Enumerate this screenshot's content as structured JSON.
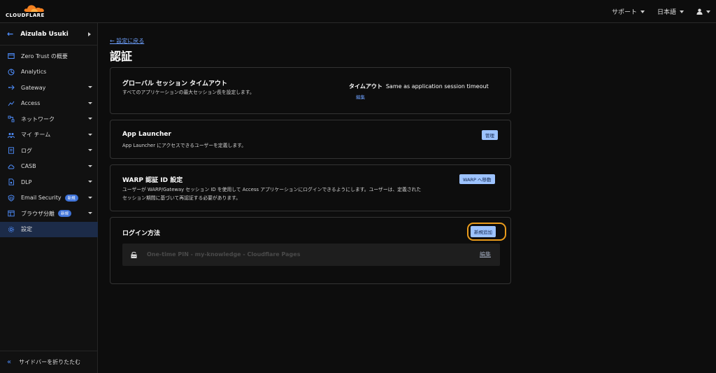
{
  "topbar": {
    "logo_text": "CLOUDFLARE",
    "support_label": "サポート",
    "language_label": "日本語"
  },
  "sidebar": {
    "account_name": "Aizulab Usuki",
    "items": [
      {
        "label": "Zero Trust の概要",
        "icon": "overview-icon",
        "has_dropdown": false
      },
      {
        "label": "Analytics",
        "icon": "analytics-icon",
        "has_dropdown": false
      },
      {
        "label": "Gateway",
        "icon": "gateway-icon",
        "has_dropdown": true
      },
      {
        "label": "Access",
        "icon": "access-icon",
        "has_dropdown": true
      },
      {
        "label": "ネットワーク",
        "icon": "network-icon",
        "has_dropdown": true
      },
      {
        "label": "マイ チーム",
        "icon": "team-icon",
        "has_dropdown": true
      },
      {
        "label": "ログ",
        "icon": "logs-icon",
        "has_dropdown": true
      },
      {
        "label": "CASB",
        "icon": "casb-icon",
        "has_dropdown": true
      },
      {
        "label": "DLP",
        "icon": "dlp-icon",
        "has_dropdown": true
      },
      {
        "label": "Email Security",
        "icon": "email-icon",
        "has_dropdown": true,
        "badge": "新規"
      },
      {
        "label": "ブラウザ分離",
        "icon": "browser-icon",
        "has_dropdown": true,
        "badge": "新規"
      },
      {
        "label": "設定",
        "icon": "gear-icon",
        "has_dropdown": false,
        "active": true
      }
    ],
    "collapse_label": "サイドバーを折りたたむ"
  },
  "main": {
    "back_link": "← 設定に戻る",
    "title": "認証",
    "session_card": {
      "title": "グローバル セッション タイムアウト",
      "description": "すべてのアプリケーションの最大セッション長を設定します。",
      "timeout_label": "タイムアウト",
      "timeout_value": "Same as application session timeout",
      "edit_label": "編集"
    },
    "launcher_card": {
      "title": "App Launcher",
      "description": "App Launcher にアクセスできるユーザーを定義します。",
      "button_label": "管理"
    },
    "warp_card": {
      "title": "WARP 認証 ID 設定",
      "description_line1": "ユーザーが WARP/Gateway セッション ID を使用して Access アプリケーションにログインできるようにします。ユーザーは、定義された",
      "description_line2": "セッション期間に基づいて再認証する必要があります。",
      "button_label": "WARP へ移動"
    },
    "login_card": {
      "title": "ログイン方法",
      "add_button_label": "新規追加",
      "methods": [
        {
          "name": "One-time PIN - my-knowledge - Cloudflare Pages",
          "edit_label": "編集"
        }
      ]
    }
  },
  "colors": {
    "accent": "#9dc3ff",
    "link": "#6ea1ff",
    "focus_ring": "#e99b1b",
    "brand_orange": "#f38020"
  }
}
